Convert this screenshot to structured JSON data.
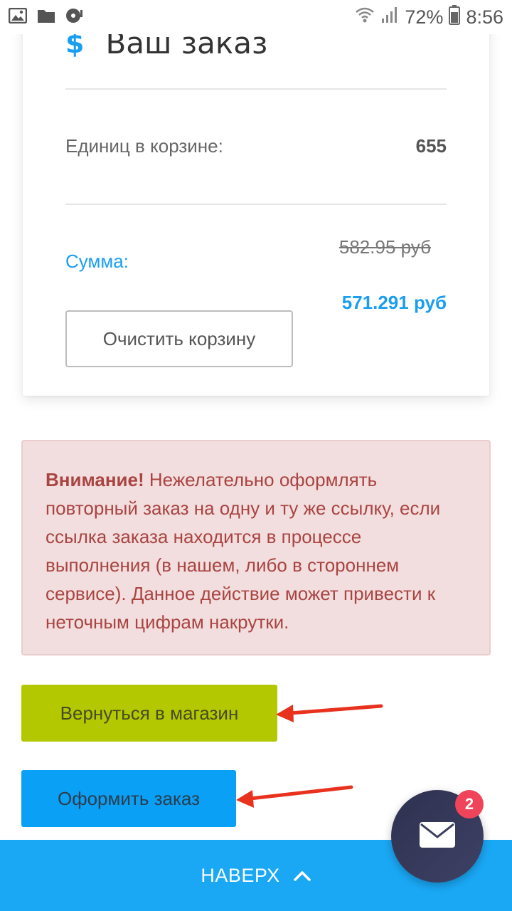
{
  "status_bar": {
    "battery_percent": "72%",
    "time": "8:56",
    "icons": [
      "image-icon",
      "folder-icon",
      "disc-icon",
      "wifi-icon",
      "signal-icon",
      "battery-icon"
    ]
  },
  "cart": {
    "title": "Ваш заказ",
    "title_icon": "dollar-icon",
    "units_label": "Единиц в корзине:",
    "units_value": "655",
    "sum_label": "Сумма:",
    "old_price": "582.95 руб",
    "new_price": "571.291 руб",
    "clear_button": "Очистить корзину"
  },
  "alert": {
    "strong": "Внимание!",
    "text": " Нежелательно оформлять повторный заказ на одну и ту же ссылку, если ссылка заказа находится в процессе выполнения (в нашем, либо в стороннем сервисе). Данное действие может привести к неточным цифрам накрутки."
  },
  "actions": {
    "back_to_shop": "Вернуться в магазин",
    "checkout": "Оформить заказ"
  },
  "footer": {
    "to_top": "НАВЕРХ"
  },
  "chat": {
    "badge_count": "2"
  },
  "colors": {
    "accent_blue": "#1a9ef0",
    "shop_button": "#b4c800",
    "checkout_button": "#0aa0f5",
    "footer_bar": "#1aa8f5",
    "alert_bg": "#f2dede",
    "alert_text": "#a94442",
    "badge": "#f0445a",
    "arrow": "#e8321e"
  }
}
